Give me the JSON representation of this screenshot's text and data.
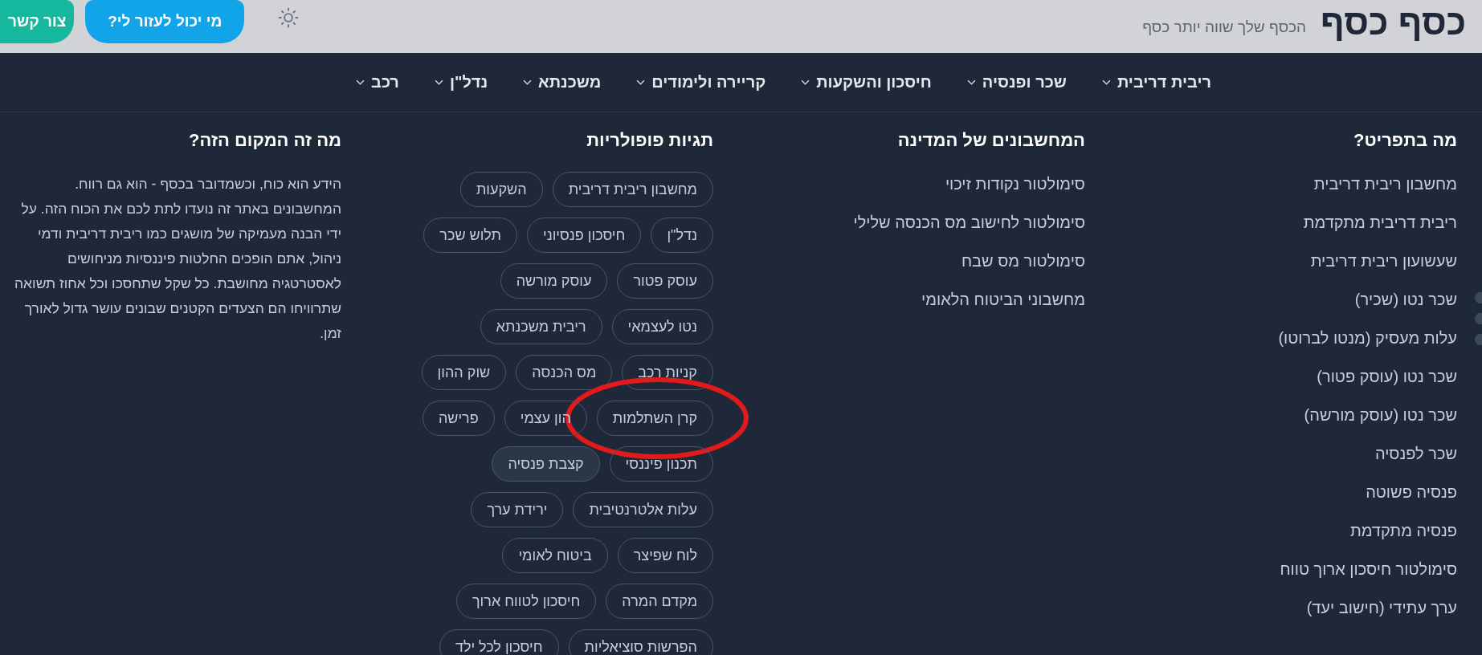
{
  "header": {
    "logo": "כסף כסף",
    "tagline": "הכסף שלך שווה יותר כסף",
    "buttons": [
      {
        "label": "מי יכול לעזור לי?",
        "kind": "primary"
      },
      {
        "label": "צור קשר",
        "kind": "accent"
      }
    ]
  },
  "nav": [
    {
      "label": "ריבית דריבית"
    },
    {
      "label": "שכר ופנסיה"
    },
    {
      "label": "חיסכון והשקעות"
    },
    {
      "label": "קריירה ולימודים"
    },
    {
      "label": "משכנתא"
    },
    {
      "label": "נדל\"ן"
    },
    {
      "label": "רכב"
    }
  ],
  "columns": [
    {
      "kind": "links",
      "title": "מה בתפריט?",
      "items": [
        "מחשבון ריבית דריבית",
        "ריבית דריבית מתקדמת",
        "שעשועון ריבית דריבית",
        "שכר נטו (שכיר)",
        "עלות מעסיק (מנטו לברוטו)",
        "שכר נטו (עוסק פטור)",
        "שכר נטו (עוסק מורשה)",
        "שכר לפנסיה",
        "פנסיה פשוטה",
        "פנסיה מתקדמת",
        "סימולטור חיסכון ארוך טווח",
        "ערך עתידי (חישוב יעד)"
      ]
    },
    {
      "kind": "links",
      "title": "המחשבונים של המדינה",
      "items": [
        "סימולטור נקודות זיכוי",
        "סימולטור לחישוב מס הכנסה שלילי",
        "סימולטור מס שבח",
        "מחשבוני הביטוח הלאומי"
      ]
    },
    {
      "kind": "tags",
      "title": "תגיות פופולריות",
      "tags": [
        {
          "label": "מחשבון ריבית דריבית",
          "selected": false,
          "annotated": false
        },
        {
          "label": "השקעות",
          "selected": false,
          "annotated": false
        },
        {
          "label": "נדל\"ן",
          "selected": false,
          "annotated": false
        },
        {
          "label": "חיסכון פנסיוני",
          "selected": false,
          "annotated": false
        },
        {
          "label": "תלוש שכר",
          "selected": false,
          "annotated": false
        },
        {
          "label": "עוסק פטור",
          "selected": false,
          "annotated": false
        },
        {
          "label": "עוסק מורשה",
          "selected": false,
          "annotated": false
        },
        {
          "label": "נטו לעצמאי",
          "selected": false,
          "annotated": false
        },
        {
          "label": "ריבית משכנתא",
          "selected": false,
          "annotated": false
        },
        {
          "label": "קניות רכב",
          "selected": false,
          "annotated": false
        },
        {
          "label": "מס הכנסה",
          "selected": false,
          "annotated": false
        },
        {
          "label": "שוק ההון",
          "selected": false,
          "annotated": false
        },
        {
          "label": "קרן השתלמות",
          "selected": false,
          "annotated": true
        },
        {
          "label": "הון עצמי",
          "selected": false,
          "annotated": false
        },
        {
          "label": "פרישה",
          "selected": false,
          "annotated": false
        },
        {
          "label": "תכנון פיננסי",
          "selected": false,
          "annotated": false
        },
        {
          "label": "קצבת פנסיה",
          "selected": true,
          "annotated": false
        },
        {
          "label": "עלות אלטרנטיבית",
          "selected": false,
          "annotated": false
        },
        {
          "label": "ירידת ערך",
          "selected": false,
          "annotated": false
        },
        {
          "label": "לוח שפיצר",
          "selected": false,
          "annotated": false
        },
        {
          "label": "ביטוח לאומי",
          "selected": false,
          "annotated": false
        },
        {
          "label": "מקדם המרה",
          "selected": false,
          "annotated": false
        },
        {
          "label": "חיסכון לטווח ארוך",
          "selected": false,
          "annotated": false
        },
        {
          "label": "הפרשות סוציאליות",
          "selected": false,
          "annotated": false
        },
        {
          "label": "חיסכון לכל ילד",
          "selected": false,
          "annotated": false
        }
      ]
    },
    {
      "kind": "text",
      "title": "מה זה המקום הזה?",
      "text": "הידע הוא כוח, וכשמדובר בכסף - הוא גם רווח. המחשבונים באתר זה נועדו לתת לכם את הכוח הזה. על ידי הבנה מעמיקה של מושגים כמו ריבית דריבית ודמי ניהול, אתם הופכים החלטות פיננסיות מניחושים לאסטרטגיה מחושבת. כל שקל שתחסכו וכל אחוז תשואה שתרוויחו הם הצעדים הקטנים שבונים עושר גדול לאורך זמן."
    }
  ]
}
